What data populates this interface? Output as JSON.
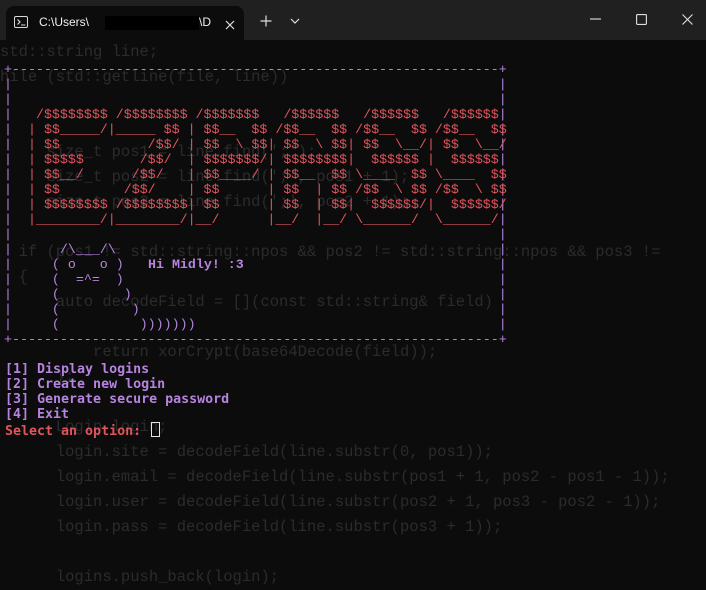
{
  "window": {
    "tab_title": "C:\\Users\\",
    "tab_title_suffix": "\\D",
    "icons": [
      "terminal-icon",
      "close-icon",
      "plus-icon",
      "chevron-down-icon",
      "minimize-icon",
      "maximize-icon",
      "close-icon"
    ]
  },
  "background_code": [
    "std::string line;",
    "hile (std::getline(file, line))",
    "",
    "",
    "     size_t pos1 = line.find(';');",
    "     size_t pos2 = line.find(';', pos1 + 1);",
    "     size_t pos3 = line.find(';', pos2 + 1);",
    "",
    "  if (pos1 != std::string::npos && pos2 != std::string::npos && pos3 !=",
    "  {",
    "      auto decodeField = [](const std::string& field)",
    "",
    "          return xorCrypt(base64Decode(field));",
    "      };",
    "",
    "      Login login;",
    "      login.site = decodeField(line.substr(0, pos1));",
    "      login.email = decodeField(line.substr(pos1 + 1, pos2 - pos1 - 1));",
    "      login.user = decodeField(line.substr(pos2 + 1, pos3 - pos2 - 1));",
    "      login.pass = decodeField(line.substr(pos3 + 1));",
    "",
    "      logins.push_back(login);"
  ],
  "banner": {
    "frame_top": "+-------------------------------------------------------------+",
    "frame_side": "|                                                             |",
    "art": [
      "  /$$$$$$$$ /$$$$$$$$ /$$$$$$$   /$$$$$$   /$$$$$$   /$$$$$$ ",
      " | $$_____/|_____ $$ | $$__  $$ /$$__  $$ /$$__  $$ /$$__  $$",
      " | $$           /$$/ | $$  \\ $$| $$  \\ $$| $$  \\__/| $$  \\__/",
      " | $$$$$       /$$/  | $$$$$$$/| $$$$$$$$|  $$$$$$ |  $$$$$$ ",
      " | $$__/      /$$/   | $$____/ | $$__  $$ \\____  $$ \\____  $$",
      " | $$        /$$/    | $$      | $$  | $$ /$$  \\ $$ /$$  \\ $$",
      " | $$$$$$$$ /$$$$$$$$| $$      | $$  | $$|  $$$$$$/|  $$$$$$/",
      " |________/|________/|__/      |__/  |__/ \\______/  \\______/ "
    ],
    "cat": [
      "     /\\___/\\",
      "    ( o   o )",
      "    (  =^=  )",
      "    (        )",
      "    (         )",
      "    (          )))))))"
    ],
    "greeting": "Hi Midly! :3"
  },
  "menu": {
    "options": [
      "[1] Display logins",
      "[2] Create new login",
      "[3] Generate secure password",
      "[4] Exit"
    ],
    "prompt": "Select an option: "
  },
  "colors": {
    "frame": "#b683e0",
    "art": "#e0545d",
    "prompt": "#e0545d",
    "background": "#0c0c0c",
    "titlebar": "#202020"
  }
}
